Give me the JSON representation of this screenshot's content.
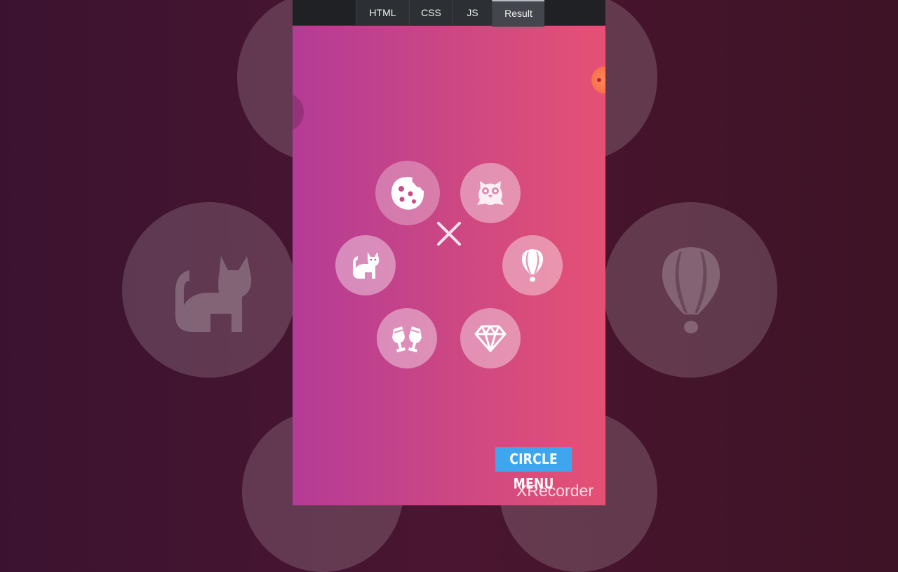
{
  "tabs": [
    {
      "label": "HTML",
      "active": false
    },
    {
      "label": "CSS",
      "active": false
    },
    {
      "label": "JS",
      "active": false
    },
    {
      "label": "Result",
      "active": true
    }
  ],
  "menu": {
    "items": [
      {
        "icon": "cookie-icon"
      },
      {
        "icon": "owl-icon"
      },
      {
        "icon": "cat-icon"
      },
      {
        "icon": "hot-air-balloon-icon"
      },
      {
        "icon": "toast-glasses-icon"
      },
      {
        "icon": "diamond-icon"
      }
    ],
    "close_icon": "close-icon"
  },
  "overlay": {
    "label": "CIRCLE MENU",
    "watermark": "XRecorder"
  },
  "colors": {
    "gradient_start": "#b43b96",
    "gradient_end": "#e55174",
    "label_bg": "#3ea6ee"
  }
}
